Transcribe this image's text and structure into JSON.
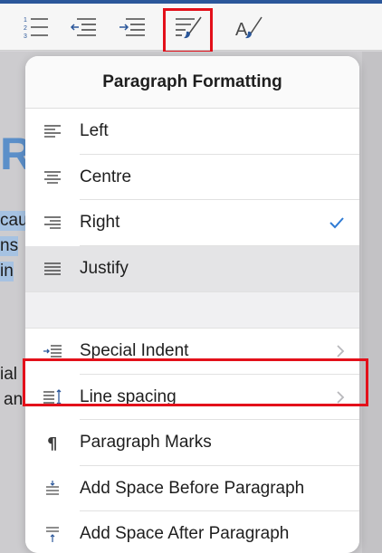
{
  "popover": {
    "title": "Paragraph Formatting",
    "alignment_items": [
      {
        "label": "Left",
        "icon": "align-left-icon",
        "selected": false
      },
      {
        "label": "Centre",
        "icon": "align-center-icon",
        "selected": false
      },
      {
        "label": "Right",
        "icon": "align-right-icon",
        "selected": false,
        "checked": true
      },
      {
        "label": "Justify",
        "icon": "align-justify-icon",
        "selected": true
      }
    ],
    "more_items": [
      {
        "label": "Special Indent",
        "icon": "special-indent-icon",
        "chevron": true
      },
      {
        "label": "Line spacing",
        "icon": "line-spacing-icon",
        "chevron": true
      },
      {
        "label": "Paragraph Marks",
        "icon": "pilcrow-icon",
        "chevron": false
      },
      {
        "label": "Add Space Before Paragraph",
        "icon": "space-before-icon",
        "chevron": false
      },
      {
        "label": "Add Space After Paragraph",
        "icon": "space-after-icon",
        "chevron": false
      }
    ]
  },
  "toolbar": {
    "buttons": [
      {
        "icon": "numbered-list-icon"
      },
      {
        "icon": "decrease-indent-icon"
      },
      {
        "icon": "increase-indent-icon"
      },
      {
        "icon": "paragraph-formatting-icon",
        "highlighted": true
      },
      {
        "icon": "styles-icon"
      }
    ]
  },
  "document": {
    "fragments": [
      "R",
      "cau",
      "ns",
      "in",
      "ial",
      "an"
    ]
  },
  "colors": {
    "accent": "#2b579a",
    "checkmark": "#2f7bd4",
    "highlight_box": "#e3101a",
    "icon": "#4a4a4a"
  }
}
